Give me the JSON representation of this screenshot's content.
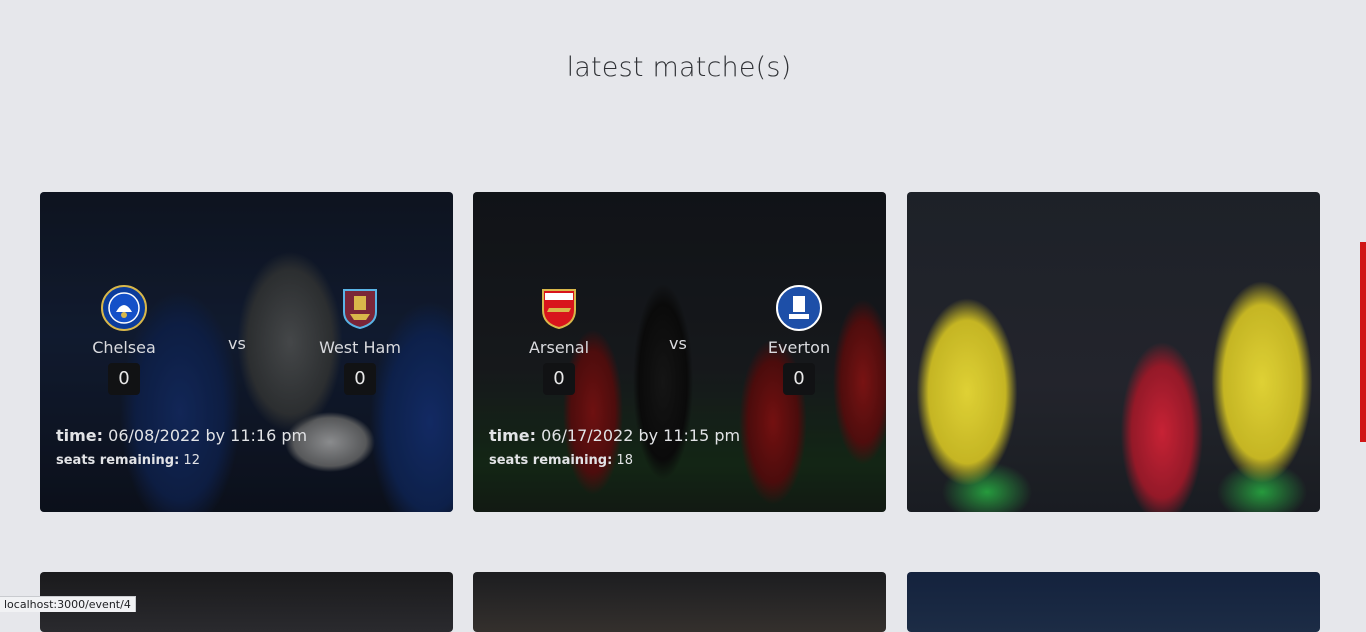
{
  "page": {
    "title": "latest matche(s)"
  },
  "matches": [
    {
      "home": {
        "name": "Chelsea",
        "crest": "chelsea-crest-icon",
        "score": "0"
      },
      "away": {
        "name": "West Ham",
        "crest": "west-ham-crest-icon",
        "score": "0"
      },
      "vs": "vs",
      "time_label": "time:",
      "time_value": "06/08/2022 by 11:16 pm",
      "seats_label": "seats remaining:",
      "seats_value": "12"
    },
    {
      "home": {
        "name": "Arsenal",
        "crest": "arsenal-crest-icon",
        "score": "0"
      },
      "away": {
        "name": "Everton",
        "crest": "everton-crest-icon",
        "score": "0"
      },
      "vs": "vs",
      "time_label": "time:",
      "time_value": "06/17/2022 by 11:15 pm",
      "seats_label": "seats remaining:",
      "seats_value": "18"
    }
  ],
  "status_bar": {
    "url": "localhost:3000/event/4"
  },
  "colors": {
    "background": "#e6e7eb",
    "accent": "#d01616",
    "score_box": "#111214"
  }
}
